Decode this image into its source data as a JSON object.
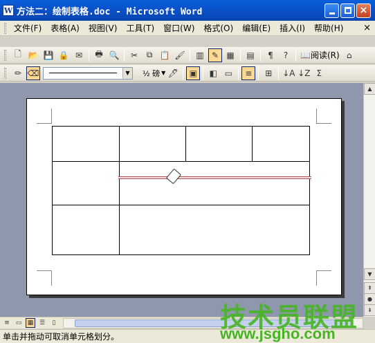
{
  "window": {
    "title": "方法二：绘制表格.doc - Microsoft Word",
    "app_icon_letter": "W"
  },
  "menu": {
    "items": [
      "文件(F)",
      "表格(A)",
      "视图(V)",
      "工具(T)",
      "窗口(W)",
      "格式(O)",
      "编辑(E)",
      "插入(I)",
      "帮助(H)"
    ],
    "close_glyph": "×"
  },
  "toolbar1": {
    "read_label": "阅读(R)"
  },
  "toolbar2": {
    "line_weight": "½ 磅"
  },
  "icons": {
    "new": "🗋",
    "open": "📂",
    "save": "💾",
    "permission": "🔒",
    "email": "✉",
    "print": "🖶",
    "preview": "🔍",
    "cut": "✂",
    "copy": "⧉",
    "paste": "📋",
    "format_painter": "🖌",
    "columns": "▥",
    "draw_table": "✎",
    "table_insert": "▦",
    "spreadsheet": "▤",
    "pilcrow": "¶",
    "help": "?",
    "read": "📖",
    "extra": "⌂",
    "pencil": "✏",
    "eraser": "⌫",
    "pen_color": "🖊",
    "borders": "▣",
    "shading": "◧",
    "merge": "▭",
    "align": "≡",
    "distribute": "⊞",
    "sort_asc": "↓A",
    "sort_desc": "↓Z",
    "sum": "Σ"
  },
  "scroll": {
    "up": "▲",
    "down": "▼",
    "prev_page": "⇞",
    "browse": "●",
    "next_page": "⇟"
  },
  "view_buttons": [
    "≡",
    "▭",
    "▦",
    "☰",
    "▯"
  ],
  "status": {
    "text": "单击并拖动可取消单元格划分。"
  },
  "watermark": {
    "brand": "技术员联盟",
    "url": "www.jsgho.com"
  }
}
